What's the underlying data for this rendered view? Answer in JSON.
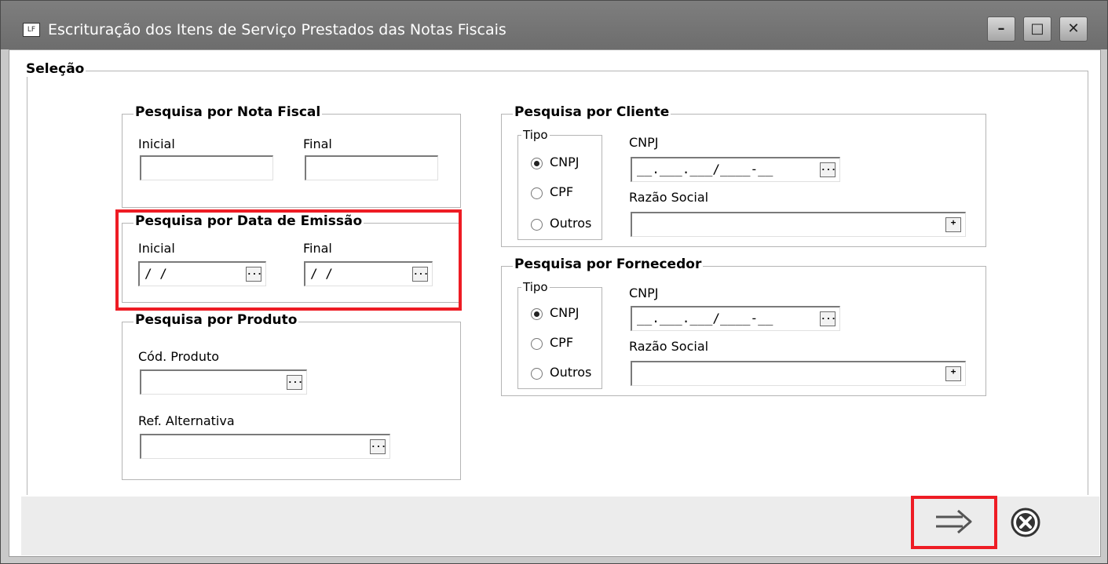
{
  "window": {
    "icon_text": "LF",
    "title": "Escrituração dos Itens de Serviço Prestados das Notas Fiscais"
  },
  "selecao": {
    "title": "Seleção"
  },
  "nota_fiscal": {
    "title": "Pesquisa por Nota Fiscal",
    "inicial_label": "Inicial",
    "final_label": "Final",
    "inicial_value": "",
    "final_value": ""
  },
  "data_emissao": {
    "title": "Pesquisa por Data de Emissão",
    "inicial_label": "Inicial",
    "final_label": "Final",
    "inicial_value": "/ /",
    "final_value": "/ /"
  },
  "produto": {
    "title": "Pesquisa por Produto",
    "cod_label": "Cód. Produto",
    "ref_label": "Ref. Alternativa",
    "cod_value": "",
    "ref_value": ""
  },
  "cliente": {
    "title": "Pesquisa por Cliente",
    "tipo_label": "Tipo",
    "options": [
      "CNPJ",
      "CPF",
      "Outros"
    ],
    "selected": "CNPJ",
    "cnpj_label": "CNPJ",
    "cnpj_value": "__.___.___/____-__",
    "razao_label": "Razão Social",
    "razao_value": ""
  },
  "fornecedor": {
    "title": "Pesquisa por Fornecedor",
    "tipo_label": "Tipo",
    "options": [
      "CNPJ",
      "CPF",
      "Outros"
    ],
    "selected": "CNPJ",
    "cnpj_label": "CNPJ",
    "cnpj_value": "__.___.___/____-__",
    "razao_label": "Razão Social",
    "razao_value": ""
  },
  "buttons": {
    "ellipsis": "...",
    "plus": "+"
  },
  "icons": {
    "next": "arrow-right-icon",
    "cancel": "cancel-icon"
  },
  "highlight_color": "#ee1c24"
}
